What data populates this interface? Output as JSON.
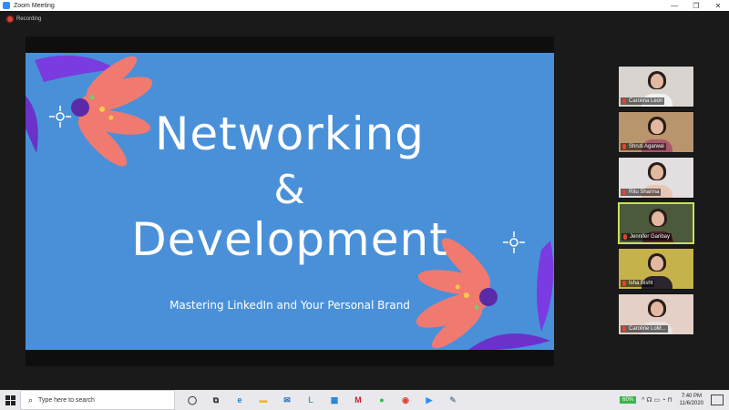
{
  "window": {
    "title": "Zoom Meeting",
    "controls": [
      "—",
      "❐",
      "✕"
    ]
  },
  "recording": {
    "label": "Recording"
  },
  "slide": {
    "title_line1": "Networking",
    "title_amp": "&",
    "title_line2": "Development",
    "subtitle": "Mastering LinkedIn and Your Personal Brand",
    "colors": {
      "background": "#4a90d9",
      "flower_coral": "#f07a6f",
      "flower_purple": "#7a3ce0",
      "text": "#ffffff"
    }
  },
  "participants": [
    {
      "name": "Carolina Leon",
      "bg": "#d9d4cf",
      "body": "#f1f1f1"
    },
    {
      "name": "Shruti Agarwal",
      "bg": "#b8956c",
      "body": "#a9576a"
    },
    {
      "name": "Ritu Sharma",
      "bg": "#e3dee0",
      "body": "#e8c6b6"
    },
    {
      "name": "Jennifer Garibay",
      "bg": "#4b5a3a",
      "body": "#4b1f2a",
      "active": true
    },
    {
      "name": "Isha Bisht",
      "bg": "#c6b24a",
      "body": "#2b2530"
    },
    {
      "name": "Caroline LoM...",
      "bg": "#e5d0c8",
      "body": "#e8e2df"
    }
  ],
  "taskbar": {
    "search_placeholder": "Type here to search",
    "apps": [
      {
        "icon": "task-view-icon",
        "glyph": "◯",
        "color": "#333333"
      },
      {
        "icon": "task-switch-icon",
        "glyph": "⧉",
        "color": "#333333"
      },
      {
        "icon": "edge-icon",
        "glyph": "e",
        "color": "#1a7fd4"
      },
      {
        "icon": "file-explorer-icon",
        "glyph": "▬",
        "color": "#e8b93a"
      },
      {
        "icon": "mail-icon",
        "glyph": "✉",
        "color": "#1f6fc2"
      },
      {
        "icon": "linkedin-learning-icon",
        "glyph": "L",
        "color": "#3aa6a0"
      },
      {
        "icon": "store-icon",
        "glyph": "▦",
        "color": "#1a7fd4"
      },
      {
        "icon": "mcafee-icon",
        "glyph": "M",
        "color": "#c8202c"
      },
      {
        "icon": "chat-app-icon",
        "glyph": "●",
        "color": "#36b54a"
      },
      {
        "icon": "chrome-icon",
        "glyph": "◉",
        "color": "#dc4437"
      },
      {
        "icon": "zoom-icon",
        "glyph": "▶",
        "color": "#2d8cff"
      },
      {
        "icon": "paint-icon",
        "glyph": "✎",
        "color": "#7a8fa8"
      }
    ],
    "battery": "60%",
    "tray_glyph": "^  ☊  ▭  ◔  ⊓",
    "time": "7:40 PM",
    "date": "11/6/2020"
  }
}
